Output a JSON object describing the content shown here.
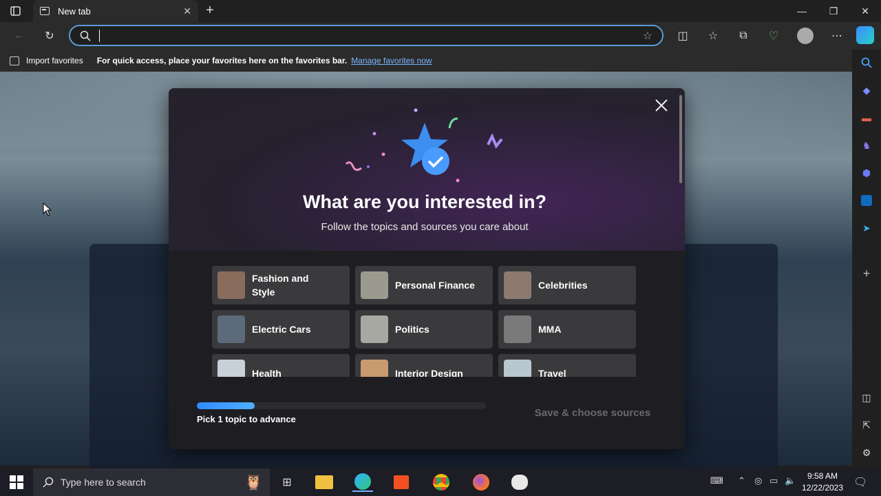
{
  "browser": {
    "tab_title": "New tab",
    "address_value": "",
    "favorites_bar": {
      "import_label": "Import favorites",
      "message": "For quick access, place your favorites here on the favorites bar.",
      "manage_link": "Manage favorites now"
    }
  },
  "modal": {
    "headline": "What are you interested in?",
    "subline": "Follow the topics and sources you care about",
    "topics": [
      {
        "label": "Fashion and Style",
        "line1": "Fashion and",
        "line2": "Style",
        "color": "#8a6c5c"
      },
      {
        "label": "Personal Finance",
        "color": "#9a9a8e"
      },
      {
        "label": "Celebrities",
        "color": "#8c7a70"
      },
      {
        "label": "Electric Cars",
        "color": "#5c6a7a"
      },
      {
        "label": "Politics",
        "color": "#a8a8a2"
      },
      {
        "label": "MMA",
        "color": "#7a7a7a"
      },
      {
        "label": "Health",
        "color": "#c8d0d8"
      },
      {
        "label": "Interior Design",
        "color": "#c89a70"
      },
      {
        "label": "Travel",
        "color": "#b8c8d0"
      }
    ],
    "progress": 0.2,
    "hint": "Pick 1 topic to advance",
    "save_label": "Save & choose sources"
  },
  "taskbar": {
    "search_placeholder": "Type here to search",
    "time": "9:58 AM",
    "date": "12/22/2023"
  },
  "colors": {
    "accent": "#2f8bff",
    "link": "#7ab6ff",
    "star": "#3c8ef0"
  }
}
